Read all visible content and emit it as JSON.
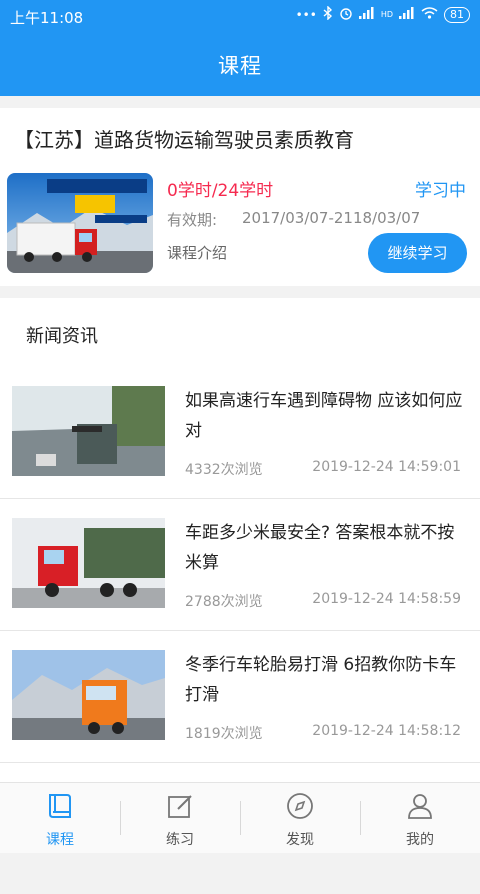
{
  "status_bar": {
    "time": "上午11:08",
    "battery": "81",
    "network": "HD"
  },
  "app_bar": {
    "title": "课程"
  },
  "course": {
    "title": "【江苏】道路货物运输驾驶员素质教育",
    "hours": "0学时/24学时",
    "status": "学习中",
    "validity_label": "有效期:",
    "validity_value": "2017/03/07-2118/03/07",
    "intro_link": "课程介绍",
    "continue_button": "继续学习",
    "banner_text": "道路普通货物运输",
    "banner_sub": "多媒体课程"
  },
  "news": {
    "header": "新闻资讯",
    "items": [
      {
        "title": "如果高速行车遇到障碍物 应该如何应对",
        "views": "4332次浏览",
        "date": "2019-12-24 14:59:01"
      },
      {
        "title": "车距多少米最安全? 答案根本就不按米算",
        "views": "2788次浏览",
        "date": "2019-12-24 14:58:59"
      },
      {
        "title": "冬季行车轮胎易打滑 6招教你防卡车打滑",
        "views": "1819次浏览",
        "date": "2019-12-24 14:58:12"
      }
    ]
  },
  "tabs": [
    {
      "label": "课程",
      "icon": "book-icon",
      "active": true
    },
    {
      "label": "练习",
      "icon": "edit-icon",
      "active": false
    },
    {
      "label": "发现",
      "icon": "compass-icon",
      "active": false
    },
    {
      "label": "我的",
      "icon": "person-icon",
      "active": false
    }
  ],
  "colors": {
    "primary": "#2196f3",
    "hours": "#f52a4f"
  }
}
